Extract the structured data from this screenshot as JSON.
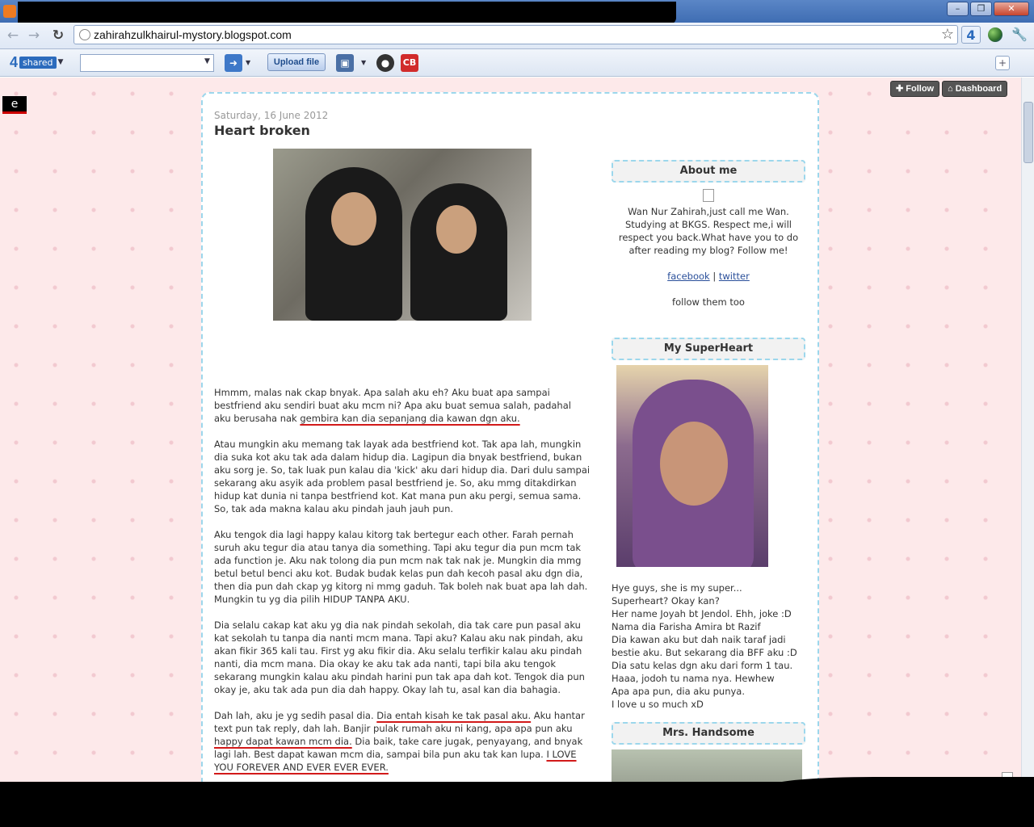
{
  "browser": {
    "url": "zahirahzulkhairul-mystory.blogspot.com",
    "min_label": "–",
    "max_label": "❐",
    "close_label": "✕",
    "back_icon": "←",
    "forward_icon": "→",
    "reload_icon": "↻",
    "star_icon": "☆",
    "wrench_icon": "🔧"
  },
  "toolbar": {
    "brand_num": "4",
    "brand_label": "shared",
    "upload_label": "Upload file",
    "cb_label": "CB",
    "plus_label": "+"
  },
  "blogger": {
    "follow_label": "Follow",
    "dashboard_label": "Dashboard"
  },
  "badge": {
    "letter": "e"
  },
  "post": {
    "date": "Saturday, 16 June 2012",
    "title": "Heart broken",
    "p1_a": "Hmmm, malas nak ckap bnyak. Apa salah aku eh? Aku buat apa sampai bestfriend aku sendiri buat aku mcm ni? Apa aku buat semua salah, padahal aku berusaha nak ",
    "p1_ul": "gembira kan dia sepanjang dia kawan dgn aku.",
    "p2": "Atau mungkin aku memang tak layak ada bestfriend kot. Tak apa lah, mungkin dia suka kot aku tak ada dalam hidup dia. Lagipun dia bnyak bestfriend, bukan aku sorg je. So, tak luak pun kalau dia 'kick' aku dari hidup dia. Dari dulu sampai sekarang aku asyik ada problem pasal bestfriend je. So, aku mmg ditakdirkan hidup kat dunia ni tanpa bestfriend kot. Kat mana pun aku pergi, semua sama. So, tak ada makna kalau aku pindah jauh jauh pun.",
    "p3": "Aku tengok dia lagi happy kalau kitorg tak bertegur each other. Farah pernah suruh aku tegur dia atau tanya dia something. Tapi aku tegur dia pun mcm tak ada function je. Aku nak tolong dia pun mcm nak tak nak je. Mungkin dia mmg betul betul benci aku kot. Budak budak kelas pun dah kecoh pasal aku dgn dia, then dia pun dah ckap yg kitorg ni mmg gaduh. Tak boleh nak buat apa lah dah. Mungkin tu yg dia pilih HIDUP TANPA AKU.",
    "p4": "Dia selalu cakap kat aku yg dia nak pindah sekolah, dia tak care pun pasal aku kat sekolah tu tanpa dia nanti mcm mana. Tapi aku? Kalau aku nak pindah, aku akan fikir 365 kali tau. First yg aku fikir dia. Aku selalu terfikir kalau aku pindah nanti, dia mcm mana. Dia okay ke aku tak ada nanti, tapi bila aku tengok sekarang mungkin kalau aku pindah harini pun tak apa dah kot. Tengok dia pun okay je, aku tak ada pun dia dah happy. Okay lah tu, asal kan dia bahagia.",
    "p5_a": "Dah lah, aku je yg sedih pasal dia. ",
    "p5_ul1": "Dia entah kisah ke tak pasal aku.",
    "p5_b": " Aku hantar text pun tak reply, dah lah. Banjir pulak rumah aku ni kang, apa apa pun aku ",
    "p5_ul2": "happy dapat kawan mcm dia.",
    "p5_c": " Dia baik, take care jugak, penyayang, and bnyak lagi lah. Best dapat kawan mcm dia, sampai bila pun aku tak kan lupa. ",
    "p5_ul3": "I LOVE YOU FOREVER AND EVER EVER EVER."
  },
  "sidebar": {
    "about_title": "About me",
    "about_text": "Wan Nur Zahirah,just call me Wan. Studying at BKGS. Respect me,i will respect you back.What have you to do after reading my blog? Follow me!",
    "facebook": "facebook",
    "sep": "|",
    "twitter": "twitter",
    "follow_too": "follow them too",
    "superheart_title": "My SuperHeart",
    "super_lines": [
      "Hye guys, she is my super...",
      "Superheart? Okay kan?",
      "Her name Joyah bt Jendol. Ehh, joke :D",
      "Nama dia Farisha Amira bt Razif",
      "Dia kawan aku but dah naik taraf jadi",
      "bestie aku. But sekarang dia BFF aku :D",
      "Dia satu kelas dgn aku dari form 1 tau.",
      "Haaa, jodoh tu nama nya. Hewhew",
      "Apa apa pun, dia aku punya.",
      "I love u so much xD"
    ],
    "handsome_title": "Mrs. Handsome"
  }
}
